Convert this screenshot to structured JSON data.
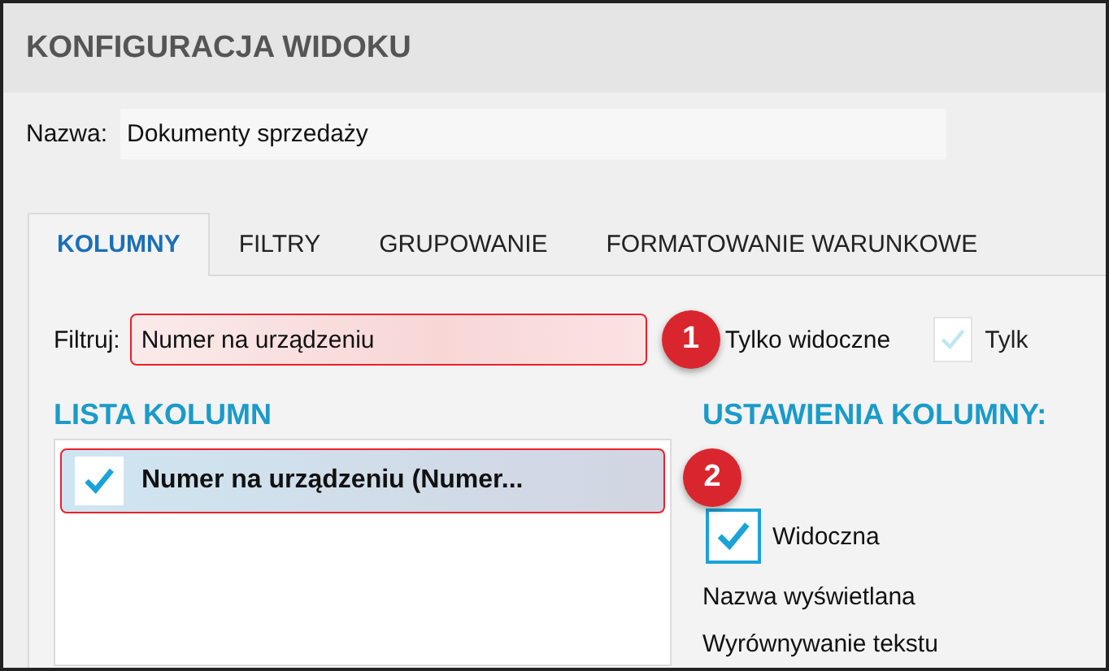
{
  "window": {
    "title": "KONFIGURACJA WIDOKU"
  },
  "name_field": {
    "label": "Nazwa:",
    "value": "Dokumenty sprzedaży"
  },
  "tabs": [
    {
      "label": "KOLUMNY",
      "selected": true
    },
    {
      "label": "FILTRY",
      "selected": false
    },
    {
      "label": "GRUPOWANIE",
      "selected": false
    },
    {
      "label": "FORMATOWANIE WARUNKOWE",
      "selected": false
    }
  ],
  "filter": {
    "label": "Filtruj:",
    "value": "Numer na urządzeniu",
    "callout": "1"
  },
  "options": [
    {
      "label": "Tylko widoczne",
      "disabled": false
    },
    {
      "label": "Tylk",
      "checked": true,
      "disabled": true
    }
  ],
  "column_list": {
    "heading": "LISTA KOLUMN",
    "items": [
      {
        "label": "Numer na urządzeniu (Numer...",
        "checked": true,
        "selected": true,
        "callout": "2"
      }
    ]
  },
  "column_settings": {
    "heading": "USTAWIENIA KOLUMNY:",
    "visible": {
      "label": "Widoczna",
      "checked": true
    },
    "fields": [
      "Nazwa wyświetlana",
      "Wyrównywanie tekstu"
    ]
  }
}
